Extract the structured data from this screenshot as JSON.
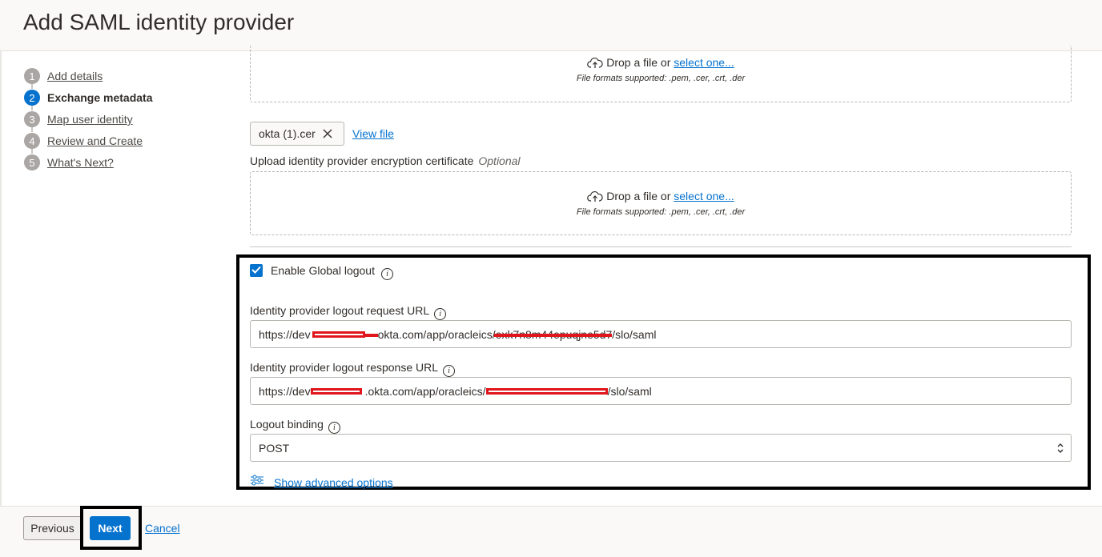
{
  "page": {
    "title": "Add SAML identity provider"
  },
  "steps": [
    {
      "num": "1",
      "label": "Add details",
      "active": false
    },
    {
      "num": "2",
      "label": "Exchange metadata",
      "active": true
    },
    {
      "num": "3",
      "label": "Map user identity",
      "active": false
    },
    {
      "num": "4",
      "label": "Review and Create",
      "active": false
    },
    {
      "num": "5",
      "label": "What's Next?",
      "active": false
    }
  ],
  "signing_upload": {
    "drop_text": "Drop a file or ",
    "select_link": "select one...",
    "formats": "File formats supported: .pem, .cer, .crt, .der"
  },
  "uploaded_file": {
    "name": "okta (1).cer",
    "view_link": "View file"
  },
  "encryption_upload": {
    "label": "Upload identity provider encryption certificate",
    "optional": "Optional",
    "drop_text": "Drop a file or ",
    "select_link": "select one...",
    "formats": "File formats supported: .pem, .cer, .crt, .der"
  },
  "global_logout": {
    "label": "Enable Global logout",
    "checked": true
  },
  "logout_request": {
    "label": "Identity provider logout request URL",
    "prefix": "https://dev",
    "middle": "okta.com/app/oracleics/",
    "obscured": "exk7n8m44epuqjne5d7",
    "suffix": "/slo/saml"
  },
  "logout_response": {
    "label": "Identity provider logout response URL",
    "prefix": "https://dev",
    "middle": ".okta.com/app/oracleics/",
    "suffix": "/slo/saml"
  },
  "logout_binding": {
    "label": "Logout binding",
    "value": "POST"
  },
  "advanced": {
    "label": "Show advanced options"
  },
  "footer": {
    "previous": "Previous",
    "next": "Next",
    "cancel": "Cancel"
  },
  "colors": {
    "accent": "#0572ce",
    "highlight": "#000000",
    "redaction": "#e0161c"
  },
  "icons": [
    "upload-cloud-icon",
    "close-icon",
    "info-icon",
    "checkmark-icon",
    "chevron-updown-icon",
    "sliders-icon"
  ]
}
